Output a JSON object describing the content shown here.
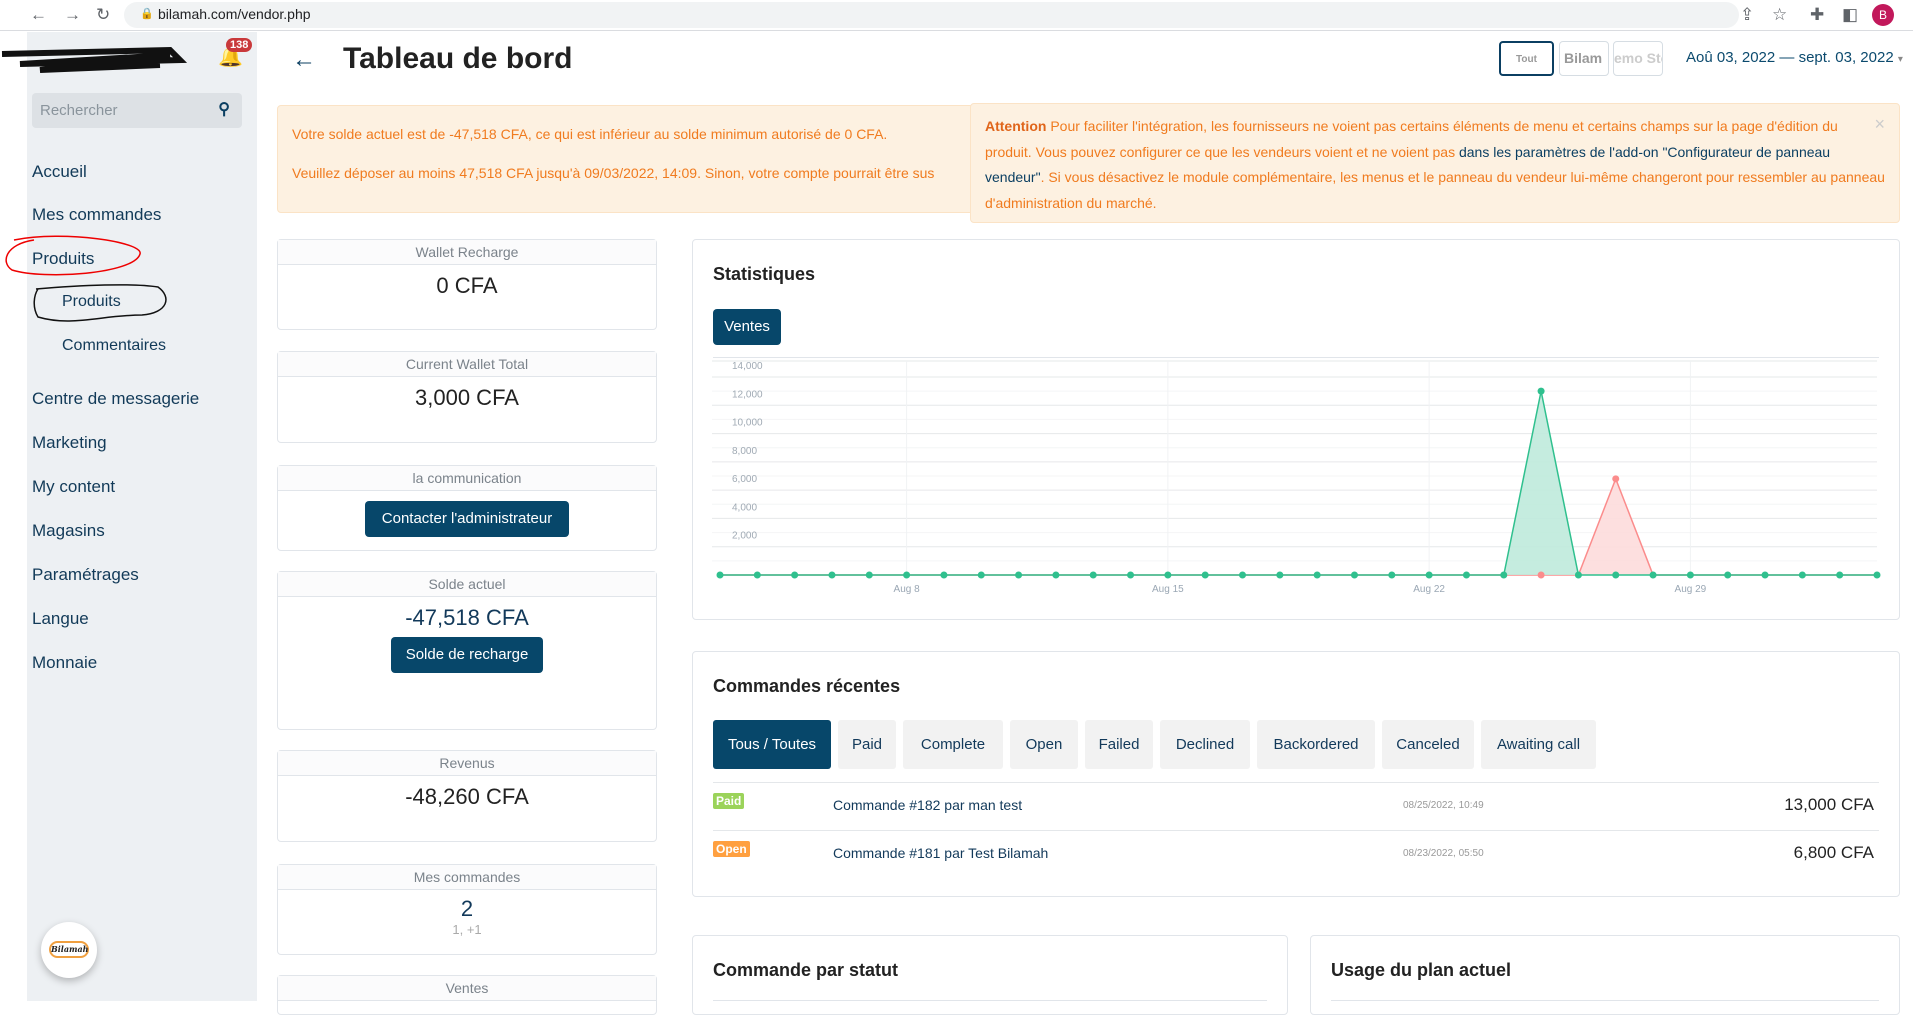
{
  "browser": {
    "url": "bilamah.com/vendor.php",
    "profile_initial": "B"
  },
  "sidebar": {
    "notification_count": "138",
    "search_placeholder": "Rechercher",
    "items": [
      {
        "label": "Accueil"
      },
      {
        "label": "Mes commandes"
      },
      {
        "label": "Produits"
      },
      {
        "label": "Produits",
        "sub": true
      },
      {
        "label": "Commentaires",
        "sub": true
      },
      {
        "label": "Centre de messagerie"
      },
      {
        "label": "Marketing"
      },
      {
        "label": "My content"
      },
      {
        "label": "Magasins"
      },
      {
        "label": "Paramétrages"
      },
      {
        "label": "Langue"
      },
      {
        "label": "Monnaie"
      }
    ],
    "logo_text": "Bilamah"
  },
  "header": {
    "title": "Tableau de bord",
    "stores": [
      "Tout",
      "Bilam",
      "emo Sto"
    ],
    "date_range": "Aoû 03, 2022 — sept. 03, 2022"
  },
  "alerts": {
    "balance_line1": "Votre solde actuel est de -47,518 CFA, ce qui est inférieur au solde minimum autorisé de 0 CFA.",
    "balance_line2": "Veuillez déposer au moins 47,518 CFA jusqu'à 09/03/2022, 14:09. Sinon, votre compte pourrait être sus",
    "attention_label": "Attention",
    "attention_text1": " Pour faciliter l'intégration, les fournisseurs ne voient pas certains éléments de menu et certains champs sur la page d'édition du produit. Vous pouvez configurer ce que les vendeurs voient et ne voient pas ",
    "attention_link": "dans les paramètres de l'add-on \"Configurateur de panneau vendeur\"",
    "attention_text2": ". Si vous désactivez le module complémentaire, les menus et le panneau du vendeur lui-même changeront pour ressembler au panneau d'administration du marché.",
    "close": "×"
  },
  "cards": {
    "wallet_recharge": {
      "label": "Wallet Recharge",
      "value": "0 CFA"
    },
    "wallet_total": {
      "label": "Current Wallet Total",
      "value": "3,000 CFA"
    },
    "communication": {
      "label": "la communication",
      "button": "Contacter l'administrateur"
    },
    "balance": {
      "label": "Solde actuel",
      "value": "-47,518 CFA",
      "button": "Solde de recharge"
    },
    "revenue": {
      "label": "Revenus",
      "value": "-48,260 CFA"
    },
    "orders": {
      "label": "Mes commandes",
      "value": "2",
      "detail": "1, +1"
    },
    "sales": {
      "label": "Ventes"
    }
  },
  "stats": {
    "title": "Statistiques",
    "tab": "Ventes"
  },
  "chart_data": {
    "type": "area",
    "x": [
      "Aug 3",
      "Aug 4",
      "Aug 5",
      "Aug 6",
      "Aug 7",
      "Aug 8",
      "Aug 9",
      "Aug 10",
      "Aug 11",
      "Aug 12",
      "Aug 13",
      "Aug 14",
      "Aug 15",
      "Aug 16",
      "Aug 17",
      "Aug 18",
      "Aug 19",
      "Aug 20",
      "Aug 21",
      "Aug 22",
      "Aug 23",
      "Aug 24",
      "Aug 25",
      "Aug 26",
      "Aug 27",
      "Aug 28",
      "Aug 29",
      "Aug 30",
      "Aug 31",
      "Sep 1",
      "Sep 2",
      "Sep 3"
    ],
    "x_tick_labels": [
      "Aug 8",
      "Aug 15",
      "Aug 22",
      "Aug 29"
    ],
    "y_tick_labels": [
      "2,000",
      "4,000",
      "6,000",
      "8,000",
      "10,000",
      "12,000",
      "14,000"
    ],
    "ylim": [
      0,
      14000
    ],
    "grid": true,
    "series": [
      {
        "color": "#fb8c8c",
        "fill": "#fddcdc",
        "values": [
          0,
          0,
          0,
          0,
          0,
          0,
          0,
          0,
          0,
          0,
          0,
          0,
          0,
          0,
          0,
          0,
          0,
          0,
          0,
          0,
          0,
          0,
          0,
          0,
          6800,
          0,
          0,
          0,
          0,
          0,
          0,
          0
        ]
      },
      {
        "color": "#2fc08e",
        "fill": "#bfeadb",
        "values": [
          0,
          0,
          0,
          0,
          0,
          0,
          0,
          0,
          0,
          0,
          0,
          0,
          0,
          0,
          0,
          0,
          0,
          0,
          0,
          0,
          0,
          0,
          13000,
          0,
          0,
          0,
          0,
          0,
          0,
          0,
          0,
          0
        ]
      }
    ]
  },
  "recent": {
    "title": "Commandes récentes",
    "tabs": [
      "Tous / Toutes",
      "Paid",
      "Complete",
      "Open",
      "Failed",
      "Declined",
      "Backordered",
      "Canceled",
      "Awaiting call"
    ],
    "orders": [
      {
        "status": "Paid",
        "status_color": "#9bd35a",
        "label": "Commande #182 par man test",
        "date": "08/25/2022, 10:49",
        "amount": "13,000 CFA"
      },
      {
        "status": "Open",
        "status_color": "#ffa040",
        "label": "Commande #181 par Test Bilamah",
        "date": "08/23/2022, 05:50",
        "amount": "6,800 CFA"
      }
    ]
  },
  "bottom": {
    "by_status_title": "Commande par statut",
    "plan_title": "Usage du plan actuel"
  }
}
